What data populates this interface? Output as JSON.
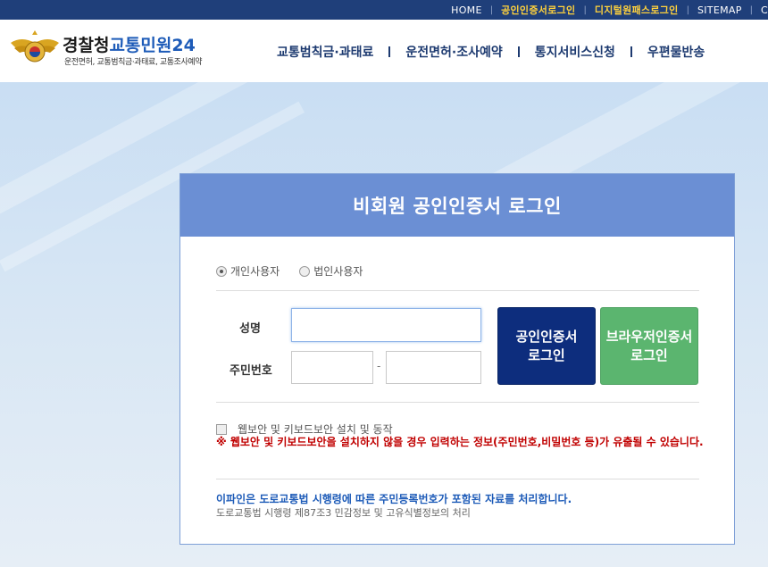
{
  "topbar": {
    "links": [
      {
        "label": "HOME",
        "highlight": false
      },
      {
        "label": "공인인증서로그인",
        "highlight": true
      },
      {
        "label": "디지털원패스로그인",
        "highlight": true
      },
      {
        "label": "SITEMAP",
        "highlight": false
      },
      {
        "label": "C",
        "highlight": false
      }
    ]
  },
  "header": {
    "logo": {
      "org": "경찰청",
      "service": "교통민원24",
      "tagline": "운전면허, 교통범칙금·과태료, 교통조사예약"
    },
    "nav": [
      {
        "label": "교통범칙금·과태료"
      },
      {
        "label": "운전면허·조사예약"
      },
      {
        "label": "통지서비스신청"
      },
      {
        "label": "우편물반송"
      }
    ]
  },
  "login": {
    "title": "비회원 공인인증서 로그인",
    "user_types": [
      {
        "label": "개인사용자",
        "selected": true
      },
      {
        "label": "법인사용자",
        "selected": false
      }
    ],
    "name_label": "성명",
    "name_value": "",
    "rrn_label": "주민번호",
    "rrn_front": "",
    "rrn_back": "",
    "rrn_separator": "-",
    "cert_button": [
      "공인인증서",
      "로그인"
    ],
    "browser_button": [
      "브라우저인증서",
      "로그인"
    ],
    "security_checkbox_label": "웹보안 및 키보드보안 설치 및 동작",
    "security_checked": false,
    "warning": "※ 웹보안 및 키보드보안을 설치하지 않을 경우 입력하는 정보(주민번호,비밀번호 등)가 유출될 수 있습니다.",
    "notice": "이파인은 도로교통법 시행령에 따른 주민등록번호가 포함된 자료를 처리합니다.",
    "legal": "도로교통법 시행령 제87조3 민감정보 및 고유식별정보의 처리"
  },
  "colors": {
    "topbar_bg": "#1f3f7a",
    "accent_yellow": "#ffd23c",
    "panel_header": "#6b8fd4",
    "cert_button": "#0d2d7d",
    "browser_button": "#5bb56f",
    "warning_text": "#c00000",
    "notice_text": "#1d5bb8"
  }
}
